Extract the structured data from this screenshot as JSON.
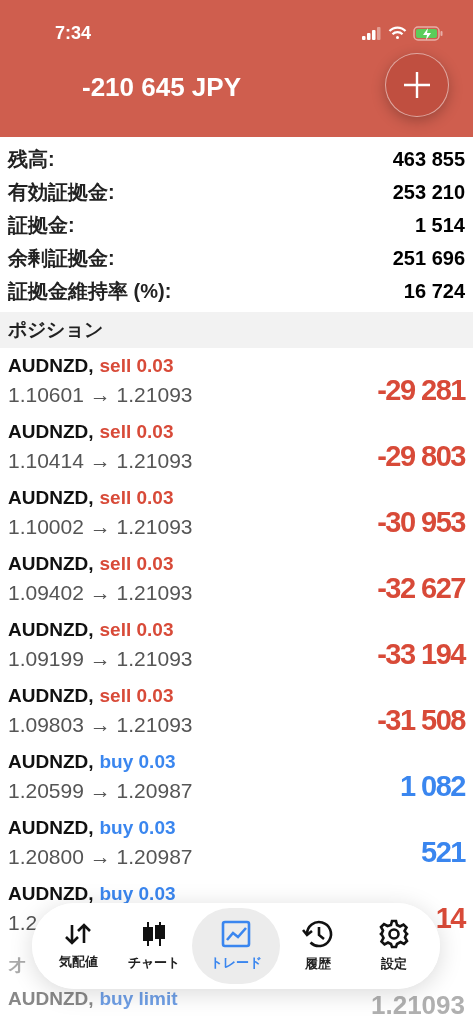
{
  "status_bar": {
    "time": "7:34"
  },
  "header": {
    "title": "-210 645 JPY"
  },
  "summary": [
    {
      "label": "残高:",
      "value": "463 855"
    },
    {
      "label": "有効証拠金:",
      "value": "253 210"
    },
    {
      "label": "証拠金:",
      "value": "1 514"
    },
    {
      "label": "余剰証拠金:",
      "value": "251 696"
    },
    {
      "label": "証拠金維持率 (%):",
      "value": "16 724"
    }
  ],
  "positions_header": "ポジション",
  "positions": [
    {
      "symbol": "AUDNZD,",
      "side": "sell 0.03",
      "color": "#d84a38",
      "prices": "1.10601 → 1.21093",
      "profit": "-29 281",
      "loss": true
    },
    {
      "symbol": "AUDNZD,",
      "side": "sell 0.03",
      "color": "#d84a38",
      "prices": "1.10414 → 1.21093",
      "profit": "-29 803",
      "loss": true
    },
    {
      "symbol": "AUDNZD,",
      "side": "sell 0.03",
      "color": "#d84a38",
      "prices": "1.10002 → 1.21093",
      "profit": "-30 953",
      "loss": true
    },
    {
      "symbol": "AUDNZD,",
      "side": "sell 0.03",
      "color": "#d84a38",
      "prices": "1.09402 → 1.21093",
      "profit": "-32 627",
      "loss": true
    },
    {
      "symbol": "AUDNZD,",
      "side": "sell 0.03",
      "color": "#d84a38",
      "prices": "1.09199 → 1.21093",
      "profit": "-33 194",
      "loss": true
    },
    {
      "symbol": "AUDNZD,",
      "side": "sell 0.03",
      "color": "#d84a38",
      "prices": "1.09803 → 1.21093",
      "profit": "-31 508",
      "loss": true
    },
    {
      "symbol": "AUDNZD,",
      "side": "buy 0.03",
      "color": "#3a86ef",
      "prices": "1.20599 → 1.20987",
      "profit": "1 082",
      "loss": false
    },
    {
      "symbol": "AUDNZD,",
      "side": "buy 0.03",
      "color": "#3a86ef",
      "prices": "1.20800 → 1.20987",
      "profit": "521",
      "loss": false
    },
    {
      "symbol": "AUDNZD,",
      "side": "buy 0.03",
      "color": "#3a86ef",
      "prices": "1.2",
      "profit": "14",
      "loss": true
    }
  ],
  "orders_header": "オ",
  "orders": [
    {
      "symbol": "AUDNZD,",
      "side": "buy limit",
      "price": "1.21093"
    }
  ],
  "tabs": [
    {
      "label": "気配値",
      "selected": false
    },
    {
      "label": "チャート",
      "selected": false
    },
    {
      "label": "トレード",
      "selected": true
    },
    {
      "label": "履歴",
      "selected": false
    },
    {
      "label": "設定",
      "selected": false
    }
  ]
}
